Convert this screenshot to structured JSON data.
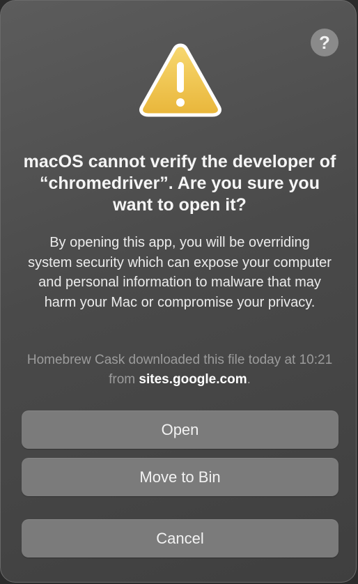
{
  "dialog": {
    "help_label": "?",
    "title": "macOS cannot verify the developer of “chromedriver”. Are you sure you want to open it?",
    "message": "By opening this app, you will be overriding system security which can expose your computer and personal information to malware that may harm your Mac or compromise your privacy.",
    "source_prefix": "Homebrew Cask downloaded this file today at 10:21 from ",
    "source_domain": "sites.google.com",
    "source_suffix": ".",
    "icon": "warning-triangle-icon",
    "buttons": {
      "open": "Open",
      "move_to_bin": "Move to Bin",
      "cancel": "Cancel"
    },
    "colors": {
      "warning_fill": "#f2c94c",
      "button_bg": "#7b7b7b",
      "dialog_bg": "#4f4f4f"
    }
  }
}
